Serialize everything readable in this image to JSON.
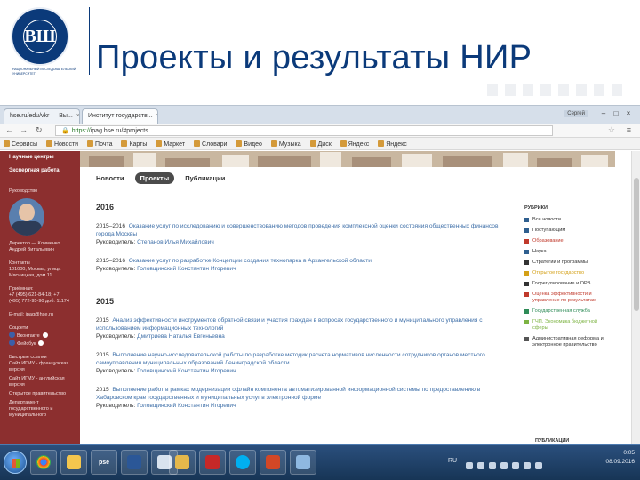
{
  "slide": {
    "title": "Проекты и результаты НИР",
    "logo_letters": "ВШ",
    "logo_caption": "НАЦИОНАЛЬНЫЙ ИССЛЕДОВАТЕЛЬСКИЙ УНИВЕРСИТЕТ"
  },
  "browser": {
    "tabs": [
      {
        "label": "hse.ru/edu/vkr — Вы..."
      },
      {
        "label": "Институт государств..."
      }
    ],
    "user_badge": "Сергей",
    "url_scheme": "https://",
    "url_host": "ipag.hse.ru",
    "url_path": "/#projects",
    "bookmarks": [
      "Сервисы",
      "Новости",
      "Почта",
      "Карты",
      "Маркет",
      "Словари",
      "Видео",
      "Музыка",
      "Диск",
      "Яндекс",
      "Яндекс"
    ]
  },
  "sidebar": {
    "items": [
      "Научные центры",
      "Экспертная работа"
    ],
    "leadership_title": "Руководство",
    "director_caption": "Директор — Клименко Андрей Витальевич",
    "contacts_title": "Контакты",
    "address": "101000, Москва, улица Мясницкая, дом 11",
    "reception_title": "Приёмная:",
    "phones": "+7 (495) 621-84-18; +7 (495) 772-95-90 доб. 11174",
    "email": "E-mail: ipag@hse.ru",
    "social_title": "Соцсети",
    "social": [
      "Вконтакте",
      "Фейсбук"
    ],
    "quick_links_title": "Быстрые ссылки",
    "quick_links": [
      "Сайт ИГМУ - французская версия",
      "Сайт ИГМУ - английская версия",
      "Открытое правительство",
      "Департамент государственного и муниципального"
    ]
  },
  "page_tabs": [
    "Новости",
    "Проекты",
    "Публикации"
  ],
  "years": [
    {
      "year": "2016",
      "projects": [
        {
          "dates": "2015–2016",
          "title": "Оказание услуг по исследованию и совершенствованию методов проведения комплексной оценки состояния общественных финансов города Москвы",
          "lead_label": "Руководитель:",
          "lead": "Степанов Илья Михайлович"
        },
        {
          "dates": "2015–2016",
          "title": "Оказание услуг по разработке Концепции создания технопарка в Архангельской области",
          "lead_label": "Руководитель:",
          "lead": "Головщинский Константин Игоревич"
        }
      ]
    },
    {
      "year": "2015",
      "projects": [
        {
          "dates": "2015",
          "title": "Анализ эффективности инструментов обратной связи и участия граждан в вопросах государственного и муниципального управления с использованием информационных технологий",
          "lead_label": "Руководитель:",
          "lead": "Дмитриева Наталья Евгеньевна"
        },
        {
          "dates": "2015",
          "title": "Выполнение научно-исследовательской работы по разработке методик расчета нормативов численности сотрудников органов местного самоуправления муниципальных образований Ленинградской области",
          "lead_label": "Руководитель:",
          "lead": "Головщинский Константин Игоревич"
        },
        {
          "dates": "2015",
          "title": "Выполнение работ в рамках модернизации офлайн компонента автоматизированной информационной системы по предоставлению в Хабаровском крае государственных и муниципальных услуг в электронной форме",
          "lead_label": "Руководитель:",
          "lead": "Головщинский Константин Игоревич"
        }
      ]
    }
  ],
  "rubrics": {
    "title": "РУБРИКИ",
    "items": [
      {
        "label": "Все новости",
        "color": "#2f5f8f"
      },
      {
        "label": "Поступающим",
        "color": "#2f5f8f"
      },
      {
        "label": "Образование",
        "color": "#c0392b"
      },
      {
        "label": "Наука",
        "color": "#2f5f8f"
      },
      {
        "label": "Стратегии и программы",
        "color": "#333333"
      },
      {
        "label": "Открытое государство",
        "color": "#d4a017"
      },
      {
        "label": "Госрегулирование и ОРВ",
        "color": "#333333"
      },
      {
        "label": "Оценка эффективности и управление по результатам",
        "color": "#c0392b"
      },
      {
        "label": "Государственная служба",
        "color": "#2e8b57"
      },
      {
        "label": "ГЧП. Экономика бюджетной сферы",
        "color": "#7cb342"
      },
      {
        "label": "Административная реформа и электронное правительство",
        "color": "#555555"
      }
    ],
    "publications_title": "ПУБЛИКАЦИИ"
  },
  "taskbar": {
    "apps": [
      "",
      "",
      "",
      "pse",
      "",
      "",
      "",
      "",
      "",
      ""
    ],
    "lang": "RU",
    "time": "0:05",
    "date": "08.09.2016"
  }
}
